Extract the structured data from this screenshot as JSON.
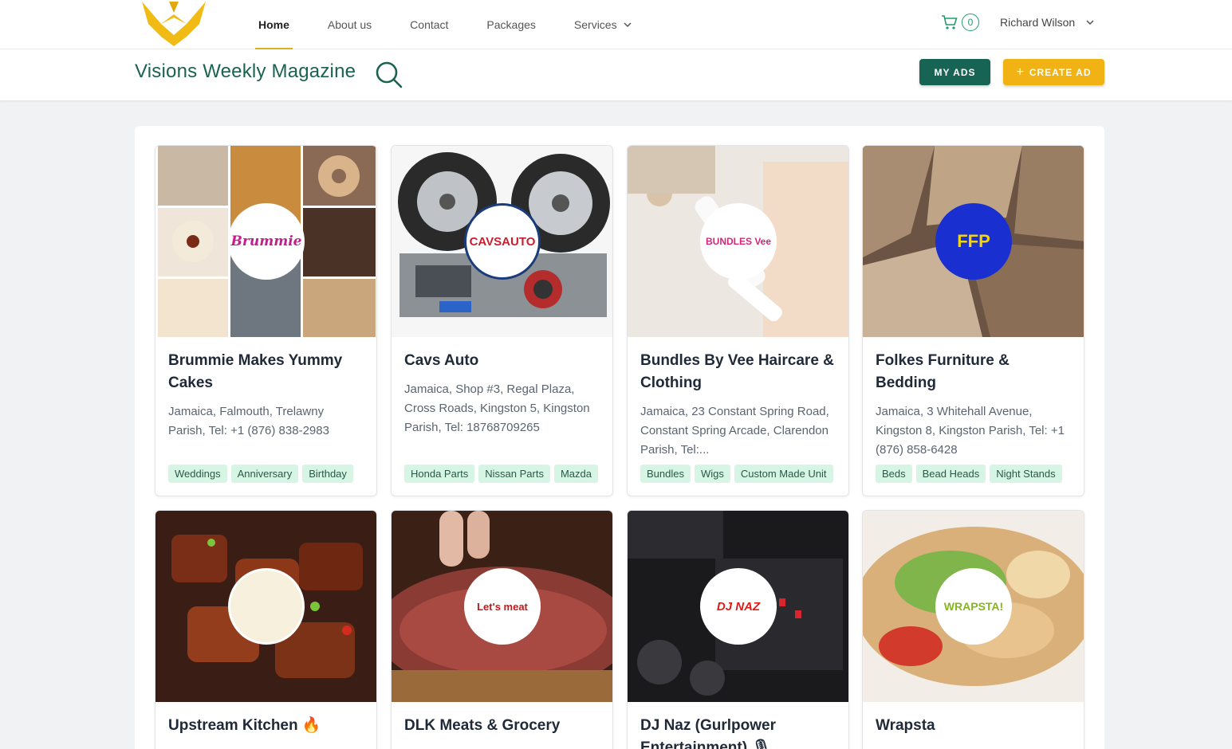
{
  "nav": {
    "items": [
      {
        "label": "Home",
        "active": true
      },
      {
        "label": "About us"
      },
      {
        "label": "Contact"
      },
      {
        "label": "Packages"
      },
      {
        "label": "Services",
        "dropdown": true
      }
    ],
    "cart_count": "0",
    "user_name": "Richard Wilson"
  },
  "header": {
    "brand": "Visions Weekly Magazine",
    "my_ads": "MY ADS",
    "create_ad": "CREATE AD"
  },
  "colors": {
    "brand_green": "#1a6350",
    "button_green": "#176455",
    "accent_yellow": "#f0b313",
    "tag_bg": "#d6f5e5"
  },
  "listings": [
    {
      "title": "Brummie Makes Yummy Cakes",
      "address": "Jamaica, Falmouth, Trelawny Parish, Tel: +1 (876) 838-2983",
      "tags": [
        "Weddings",
        "Anniversary",
        "Birthday"
      ],
      "logo_text": "Brummie"
    },
    {
      "title": "Cavs Auto",
      "address": "Jamaica, Shop #3, Regal Plaza, Cross Roads, Kingston 5, Kingston Parish, Tel: 18768709265",
      "tags": [
        "Honda Parts",
        "Nissan Parts",
        "Mazda"
      ],
      "logo_text": "CAVSAUTO"
    },
    {
      "title": "Bundles By Vee Haircare & Clothing",
      "address": "Jamaica, 23 Constant Spring Road, Constant Spring Arcade, Clarendon Parish, Tel:...",
      "tags": [
        "Bundles",
        "Wigs",
        "Custom Made Unit"
      ],
      "logo_text": "BUNDLES Vee"
    },
    {
      "title": "Folkes Furniture & Bedding",
      "address": "Jamaica, 3 Whitehall Avenue, Kingston 8, Kingston Parish, Tel: +1 (876) 858-6428",
      "tags": [
        "Beds",
        "Bead Heads",
        "Night Stands"
      ],
      "logo_text": "FFP"
    },
    {
      "title": "Upstream Kitchen 🔥",
      "address": "",
      "tags": [],
      "logo_text": ""
    },
    {
      "title": "DLK Meats & Grocery",
      "address": "",
      "tags": [],
      "logo_text": "Let's meat"
    },
    {
      "title": "DJ Naz (Gurlpower Entertainment) 🎙",
      "address": "",
      "tags": [],
      "logo_text": "DJ NAZ"
    },
    {
      "title": "Wrapsta",
      "address": "",
      "tags": [],
      "logo_text": "WRAPSTA!"
    }
  ]
}
